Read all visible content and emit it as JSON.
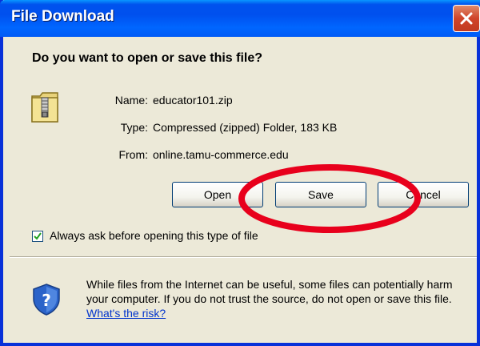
{
  "window": {
    "title": "File Download"
  },
  "dialog": {
    "question": "Do you want to open or save this file?",
    "file": {
      "name_label": "Name:",
      "name_value": "educator101.zip",
      "type_label": "Type:",
      "type_value": "Compressed (zipped) Folder, 183 KB",
      "from_label": "From:",
      "from_value": "online.tamu-commerce.edu"
    },
    "buttons": {
      "open": "Open",
      "save": "Save",
      "cancel": "Cancel"
    },
    "always_ask_label": "Always ask before opening this type of file",
    "always_ask_checked": true,
    "warning_text": "While files from the Internet can be useful, some files can potentially harm your computer. If you do not trust the source, do not open or save this file.",
    "risk_link": "What's the risk?"
  },
  "icons": {
    "file": "zip-folder-icon",
    "security": "shield-question-icon",
    "close": "close-icon",
    "check": "check-icon"
  },
  "colors": {
    "titlebar": "#0054e3",
    "dialog_bg": "#ece9d8",
    "annotation": "#e8001c",
    "link": "#0033cc"
  }
}
